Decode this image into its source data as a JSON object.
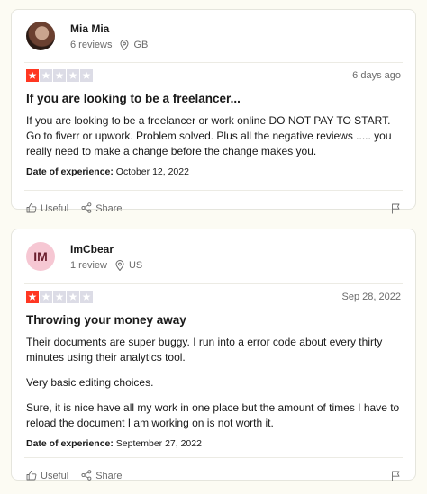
{
  "reviews": [
    {
      "name": "Mia Mia",
      "review_count": "6 reviews",
      "country": "GB",
      "rating": 1,
      "date": "6 days ago",
      "title": "If you are looking to be a freelancer...",
      "body": [
        "If you are looking to be a freelancer or work online DO NOT PAY TO START. Go to fiverr or upwork. Problem solved. Plus all the negative reviews ..... you really need to make a change before the change makes you."
      ],
      "experience_label": "Date of experience:",
      "experience_date": "October 12, 2022",
      "useful_label": "Useful",
      "share_label": "Share"
    },
    {
      "name": "ImCbear",
      "initials": "IM",
      "review_count": "1 review",
      "country": "US",
      "rating": 1,
      "date": "Sep 28, 2022",
      "title": "Throwing your money away",
      "body": [
        "Their documents are super buggy. I run into a error code about every thirty minutes using their analytics tool.",
        "Very basic editing choices.",
        "Sure, it is nice have all my work in one place but the amount of times I have to reload the document I am working on is not worth it."
      ],
      "experience_label": "Date of experience:",
      "experience_date": "September 27, 2022",
      "useful_label": "Useful",
      "share_label": "Share"
    }
  ],
  "colors": {
    "star_on": "#ff3722",
    "star_off": "#dcdce6",
    "avatar_initials_bg": "#f6c7d3"
  },
  "icons": [
    "location-pin-icon",
    "star-icon",
    "thumbs-up-icon",
    "share-icon",
    "flag-icon"
  ]
}
